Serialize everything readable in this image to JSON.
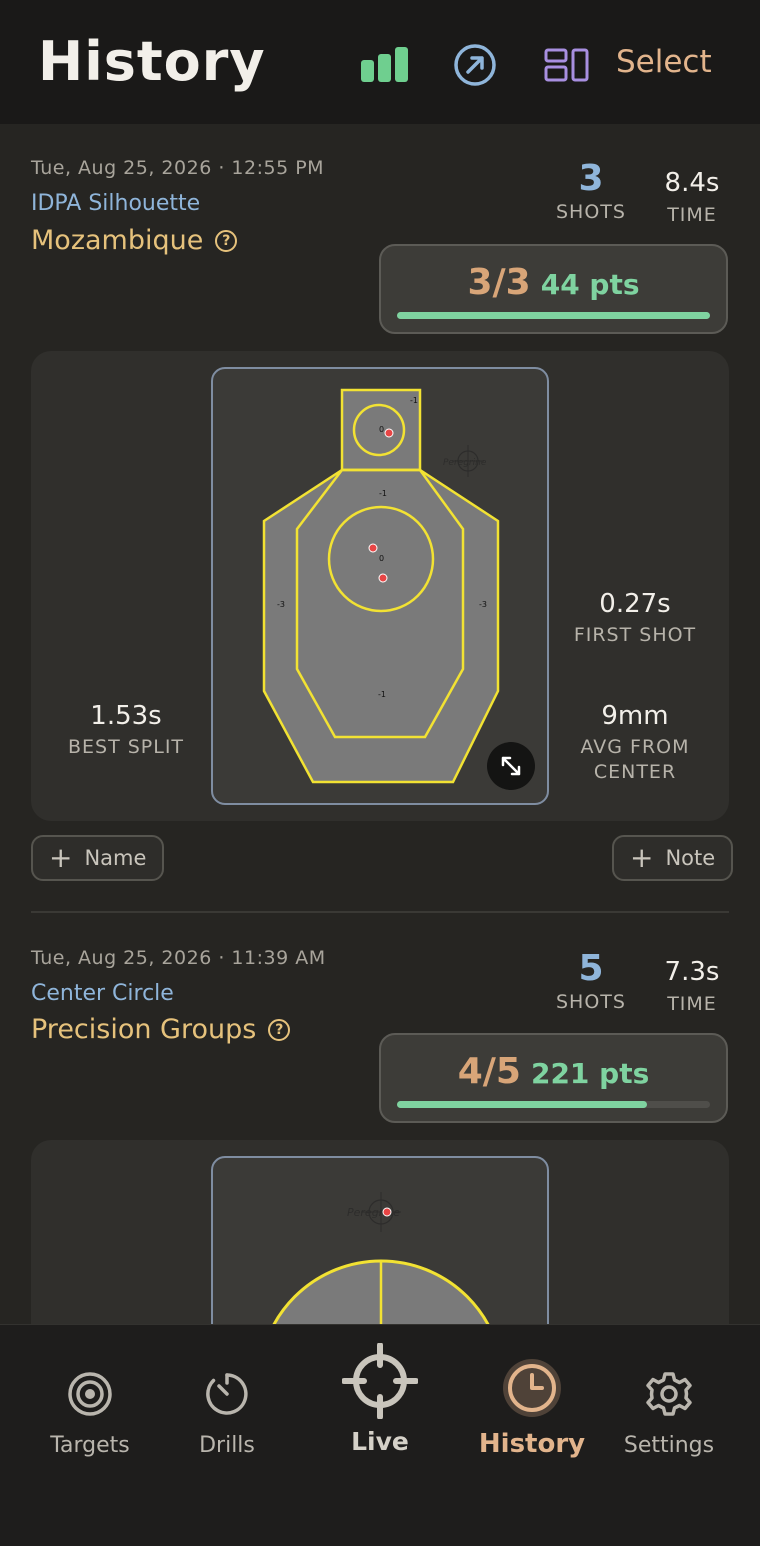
{
  "header": {
    "title": "History",
    "select_label": "Select",
    "icons": [
      "bar-chart-icon",
      "share-circle-icon",
      "layout-toggle-icon"
    ]
  },
  "sessions": [
    {
      "date": "Tue, Aug 25, 2026 · 12:55 PM",
      "target_type": "IDPA Silhouette",
      "drill": "Mozambique",
      "shots": "3",
      "shots_label": "SHOTS",
      "time": "8.4s",
      "time_label": "TIME",
      "score_fraction": "3/3",
      "score_points": "44 pts",
      "score_progress": 1.0,
      "best_split": "1.53s",
      "best_split_label": "BEST SPLIT",
      "first_shot": "0.27s",
      "first_shot_label": "FIRST SHOT",
      "avg_center": "9mm",
      "avg_center_label": "AVG FROM CENTER",
      "name_button": "Name",
      "note_button": "Note",
      "target_labels": {
        "head_outer": "-1",
        "head_center": "0",
        "body_top": "-1",
        "body_center": "0",
        "left": "-3",
        "right": "-3",
        "lower": "-1"
      },
      "watermark": "Peregrine"
    },
    {
      "date": "Tue, Aug 25, 2026 · 11:39 AM",
      "target_type": "Center Circle",
      "drill": "Precision Groups",
      "shots": "5",
      "shots_label": "SHOTS",
      "time": "7.3s",
      "time_label": "TIME",
      "score_fraction": "4/5",
      "score_points": "221 pts",
      "score_progress": 0.8,
      "watermark": "Peregrine"
    }
  ],
  "tabs": [
    {
      "label": "Targets",
      "icon": "target-icon"
    },
    {
      "label": "Drills",
      "icon": "timer-icon"
    },
    {
      "label": "Live",
      "icon": "crosshair-icon"
    },
    {
      "label": "History",
      "icon": "clock-icon",
      "active": true
    },
    {
      "label": "Settings",
      "icon": "gear-icon"
    }
  ],
  "colors": {
    "accent": "#e2b48c",
    "drill": "#e6c27c",
    "blue": "#8fb5da",
    "green": "#7fd3a0"
  }
}
